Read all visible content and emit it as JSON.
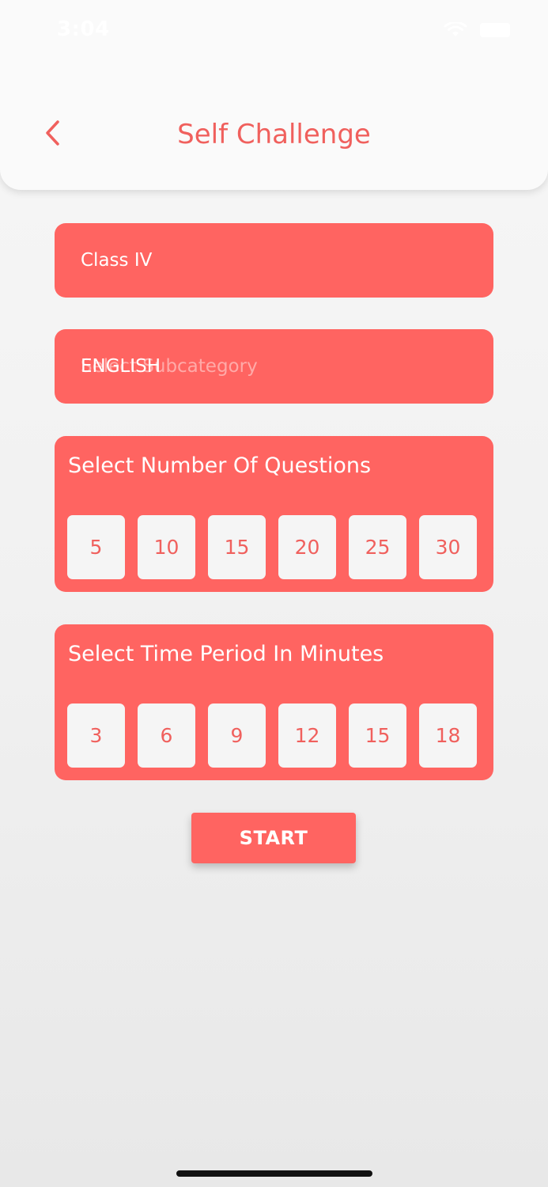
{
  "status_bar": {
    "time": "3:04"
  },
  "header": {
    "title": "Self Challenge"
  },
  "class_field": {
    "value": "Class IV"
  },
  "subject_field": {
    "value": "ENGLISH",
    "placeholder": "Select Subcategory"
  },
  "questions_panel": {
    "title": "Select Number Of Questions",
    "options": [
      "5",
      "10",
      "15",
      "20",
      "25",
      "30"
    ]
  },
  "time_panel": {
    "title": "Select Time Period In Minutes",
    "options": [
      "3",
      "6",
      "9",
      "12",
      "15",
      "18"
    ]
  },
  "start_button": {
    "label": "START"
  },
  "colors": {
    "accent": "#ff6461",
    "title_text": "#f0605d",
    "option_bg": "#f5f5f5"
  }
}
